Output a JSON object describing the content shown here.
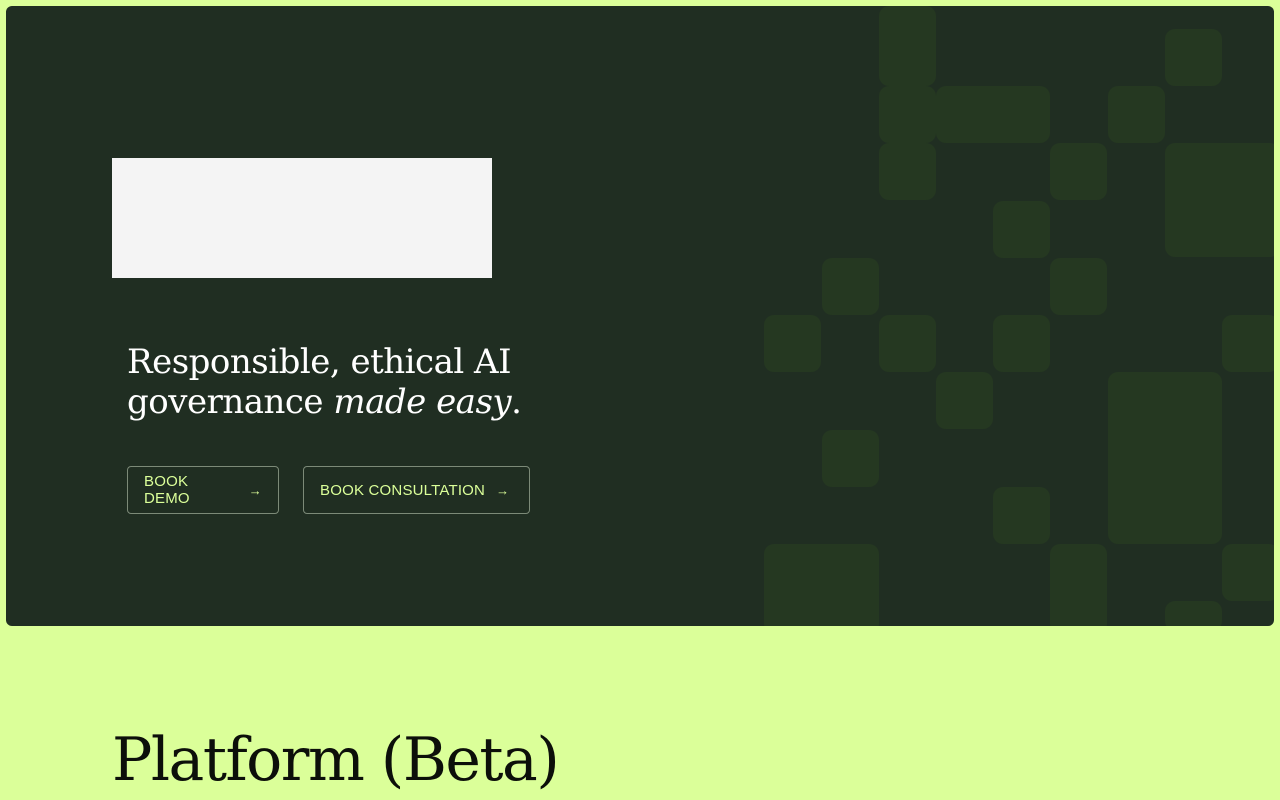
{
  "hero": {
    "headline_line1": "Responsible, ethical AI",
    "headline_line2_plain": "governance ",
    "headline_line2_italic": "made easy",
    "headline_period": ".",
    "buttons": [
      {
        "label": "BOOK DEMO",
        "icon": "arrow-right-icon",
        "arrow": "→"
      },
      {
        "label": "BOOK CONSULTATION",
        "icon": "arrow-right-icon",
        "arrow": "→"
      }
    ]
  },
  "platform": {
    "title": "Platform (Beta)"
  },
  "colors": {
    "page_background": "#dbff99",
    "hero_background": "#202e22",
    "pattern": "#253821",
    "accent_text": "#dbff99",
    "headline_text": "#ffffff"
  }
}
